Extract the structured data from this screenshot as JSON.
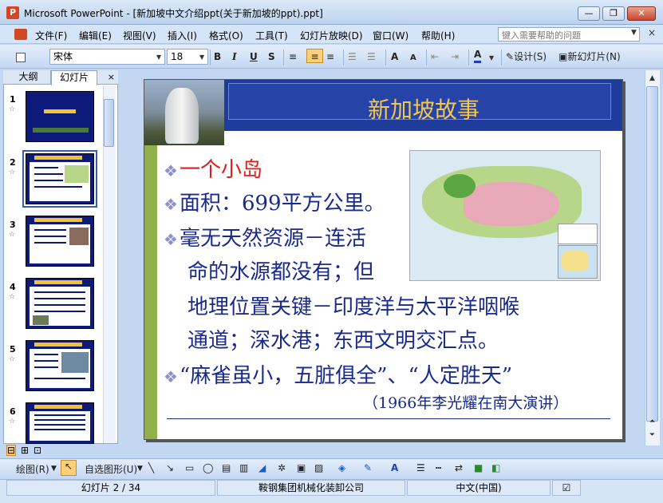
{
  "window": {
    "title": "Microsoft PowerPoint - [新加坡中文介绍ppt(关于新加坡的ppt).ppt]",
    "minimize": "—",
    "restore": "❐",
    "close": "✕"
  },
  "menu": {
    "items": [
      "文件(F)",
      "编辑(E)",
      "视图(V)",
      "插入(I)",
      "格式(O)",
      "工具(T)",
      "幻灯片放映(D)",
      "窗口(W)",
      "帮助(H)"
    ],
    "help_placeholder": "键入需要帮助的问题",
    "mdi_close": "×"
  },
  "toolbar": {
    "font_name": "宋体",
    "font_size": "18",
    "bold": "B",
    "italic": "I",
    "underline": "U",
    "shadow": "S",
    "grow": "A",
    "shrink": "A",
    "font_color": "A",
    "design": "设计(S)",
    "new_slide": "新幻灯片(N)"
  },
  "panel": {
    "tabs": [
      "大纲",
      "幻灯片"
    ],
    "close": "×",
    "slide_numbers": [
      "1",
      "2",
      "3",
      "4",
      "5",
      "6"
    ]
  },
  "slide": {
    "title": "新加坡故事",
    "bullet_mark": "❖",
    "bullets": [
      "一个小岛",
      "面积：699平方公里。",
      "毫无天然资源－连活",
      "命的水源都没有；但",
      "地理位置关键－印度洋与太平洋咽喉",
      "通道；深水港；东西文明交汇点。",
      "“麻雀虽小，五脏俱全”、“人定胜天”"
    ],
    "quote_source": "（1966年李光耀在南大演讲）"
  },
  "drawbar": {
    "draw": "绘图(R)",
    "autoshapes": "自选图形(U)"
  },
  "status": {
    "slide_info": "幻灯片 2 / 34",
    "design": "鞍钢集团机械化装卸公司",
    "language": "中文(中国)"
  }
}
